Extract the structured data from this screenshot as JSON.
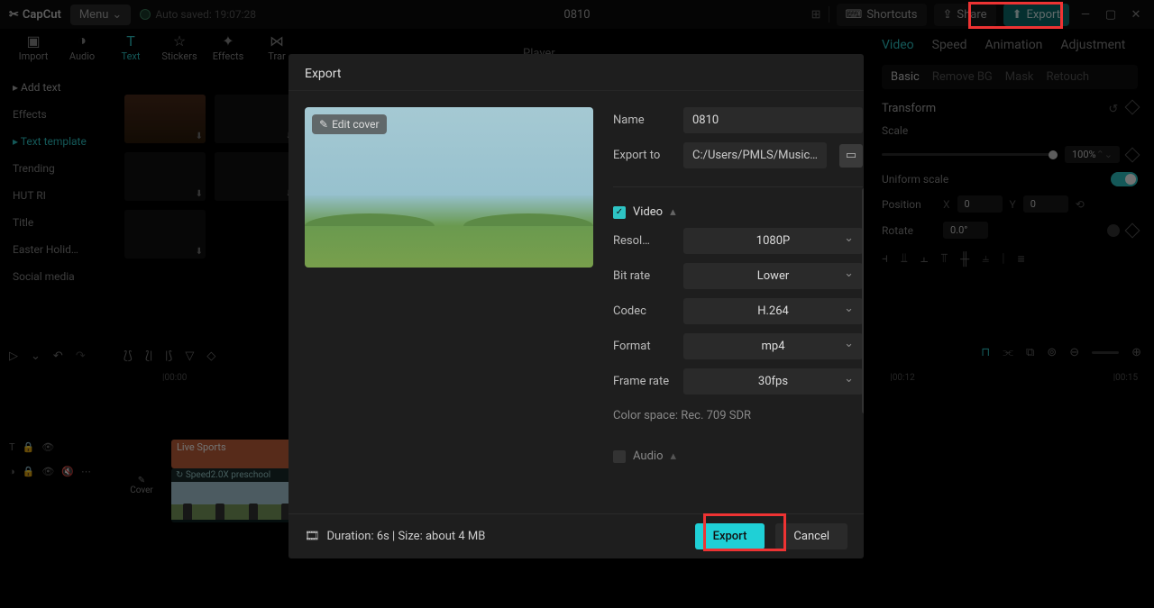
{
  "app": {
    "name": "CapCut",
    "menu_label": "Menu",
    "auto_save": "Auto saved: 19:07:28",
    "project_title": "0810"
  },
  "topbar": {
    "shortcuts": "Shortcuts",
    "share": "Share",
    "export": "Export"
  },
  "left_tabs": [
    "Import",
    "Audio",
    "Text",
    "Stickers",
    "Effects",
    "Trar"
  ],
  "sidebar": {
    "add_text": "Add text",
    "items": [
      "Effects",
      "Text template",
      "Trending",
      "HUT RI",
      "Title",
      "Easter Holid…",
      "Social media"
    ]
  },
  "player_label": "Player",
  "right_panel": {
    "tabs": [
      "Video",
      "Speed",
      "Animation",
      "Adjustment"
    ],
    "subtabs": [
      "Basic",
      "Remove BG",
      "Mask",
      "Retouch"
    ],
    "transform": "Transform",
    "scale": "Scale",
    "scale_value": "100%",
    "uniform": "Uniform scale",
    "position": "Position",
    "pos_x": "0",
    "pos_y": "0",
    "rotate": "Rotate",
    "rotate_value": "0.0°"
  },
  "timeline": {
    "ruler": [
      "00:00",
      "00:12",
      "00:15"
    ],
    "clip_label": "Live Sports",
    "clip_main": "Speed2.0X  preschool",
    "cover": "Cover"
  },
  "modal": {
    "title": "Export",
    "edit_cover": "Edit cover",
    "name_label": "Name",
    "name_value": "0810",
    "export_to_label": "Export to",
    "export_to_value": "C:/Users/PMLS/Music…",
    "video_label": "Video",
    "resolution_label": "Resol…",
    "resolution_value": "1080P",
    "bitrate_label": "Bit rate",
    "bitrate_value": "Lower",
    "codec_label": "Codec",
    "codec_value": "H.264",
    "format_label": "Format",
    "format_value": "mp4",
    "framerate_label": "Frame rate",
    "framerate_value": "30fps",
    "colorspace": "Color space: Rec. 709 SDR",
    "audio_label": "Audio",
    "duration": "Duration: 6s | Size: about 4 MB",
    "export_btn": "Export",
    "cancel_btn": "Cancel"
  }
}
